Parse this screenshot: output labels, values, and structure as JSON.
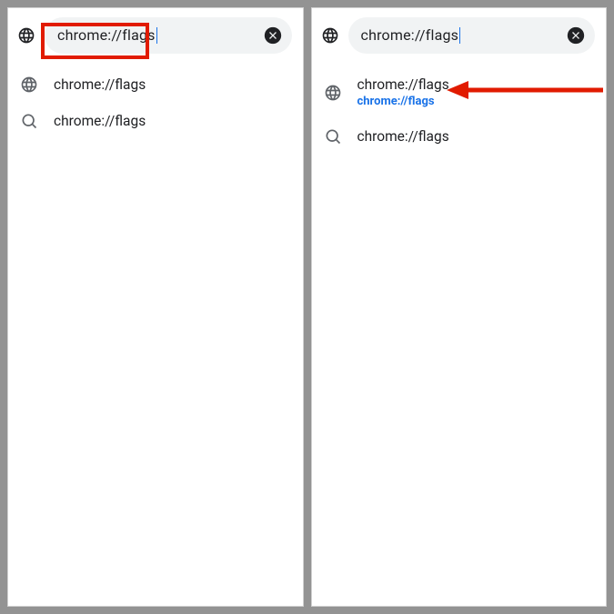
{
  "left": {
    "omnibox_value": "chrome://flags",
    "suggestions": [
      {
        "primary": "chrome://flags",
        "secondary": "",
        "icon": "globe"
      },
      {
        "primary": "chrome://flags",
        "secondary": "",
        "icon": "search"
      }
    ]
  },
  "right": {
    "omnibox_value": "chrome://flags",
    "suggestions": [
      {
        "primary": "chrome://flags",
        "secondary": "chrome://flags",
        "icon": "globe"
      },
      {
        "primary": "chrome://flags",
        "secondary": "",
        "icon": "search"
      }
    ]
  },
  "colors": {
    "annotation_red": "#e11b00",
    "link_blue": "#1a73e8",
    "text": "#202124",
    "muted": "#5f6368",
    "omnibox_bg": "#f1f3f4"
  }
}
